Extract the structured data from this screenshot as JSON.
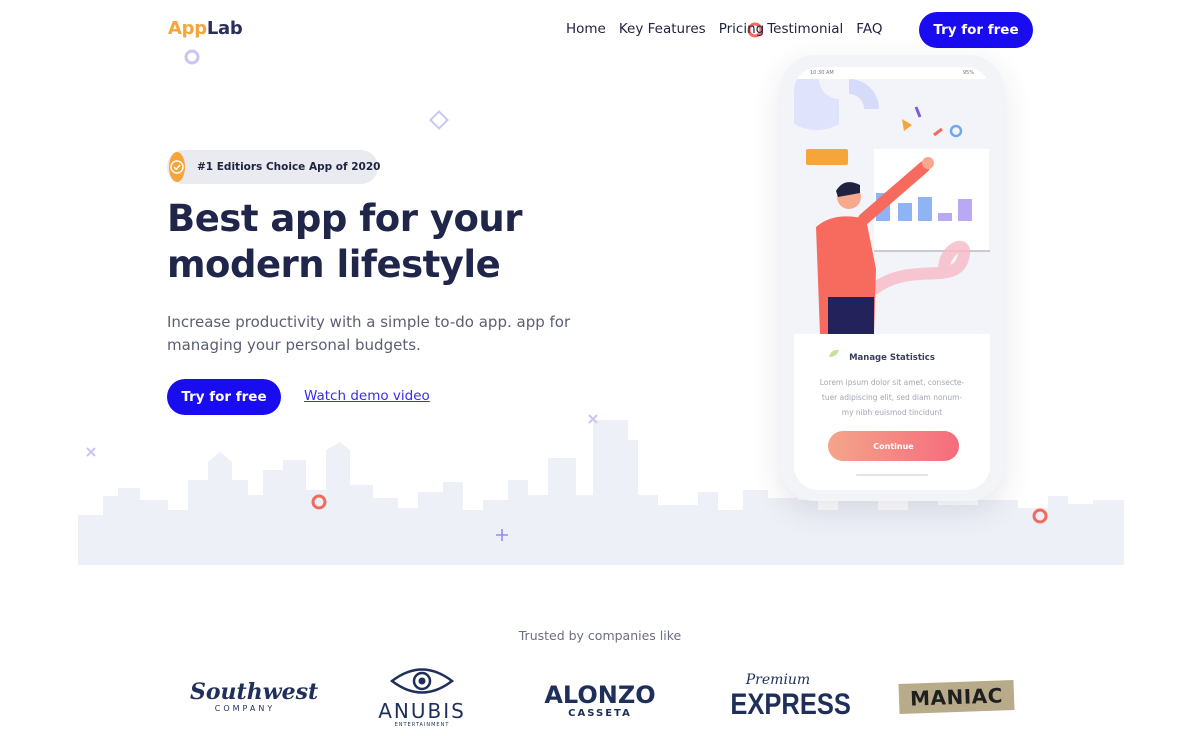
{
  "brand": {
    "part1": "App",
    "part2": "Lab"
  },
  "nav": {
    "items": [
      "Home",
      "Key Features",
      "Pricing",
      "Testimonial",
      "FAQ"
    ],
    "cta": "Try for free"
  },
  "hero": {
    "badge": "#1 Editiors Choice App of 2020",
    "title_line1": "Best app for your",
    "title_line2": "modern lifestyle",
    "subtitle": "Increase productivity with a simple to-do app. app for managing your personal budgets.",
    "cta": "Try for free",
    "secondary_link": "Watch demo video"
  },
  "phone": {
    "status_time": "10:30 AM",
    "status_battery": "95%",
    "card_title": "Manage Statistics",
    "card_body_line1": "Lorem ipsum dolor sit amet, consecte-",
    "card_body_line2": "tuer adipiscing elit, sed diam nonum-",
    "card_body_line3": "my nibh euismod tincidunt",
    "continue_label": "Continue"
  },
  "trusted": {
    "heading": "Trusted by companies like",
    "logos": [
      {
        "name": "Southwest",
        "sub": "COMPANY"
      },
      {
        "name": "ANUBIS",
        "sub": "ENTERTAINMENT"
      },
      {
        "name": "ALONZO",
        "sub": "CASSETA"
      },
      {
        "name": "EXPRESS",
        "sub": "Premium"
      },
      {
        "name": "MANIAC",
        "sub": ""
      }
    ]
  },
  "colors": {
    "primary": "#1a0cf0",
    "accent_orange": "#f5a53a",
    "heading": "#20254a",
    "skyline": "#eef0f7"
  },
  "icons": [
    "check-badge-icon",
    "diamond-decoration-icon",
    "ring-decoration-icon",
    "cross-decoration-icon",
    "plus-decoration-icon",
    "eye-icon"
  ]
}
